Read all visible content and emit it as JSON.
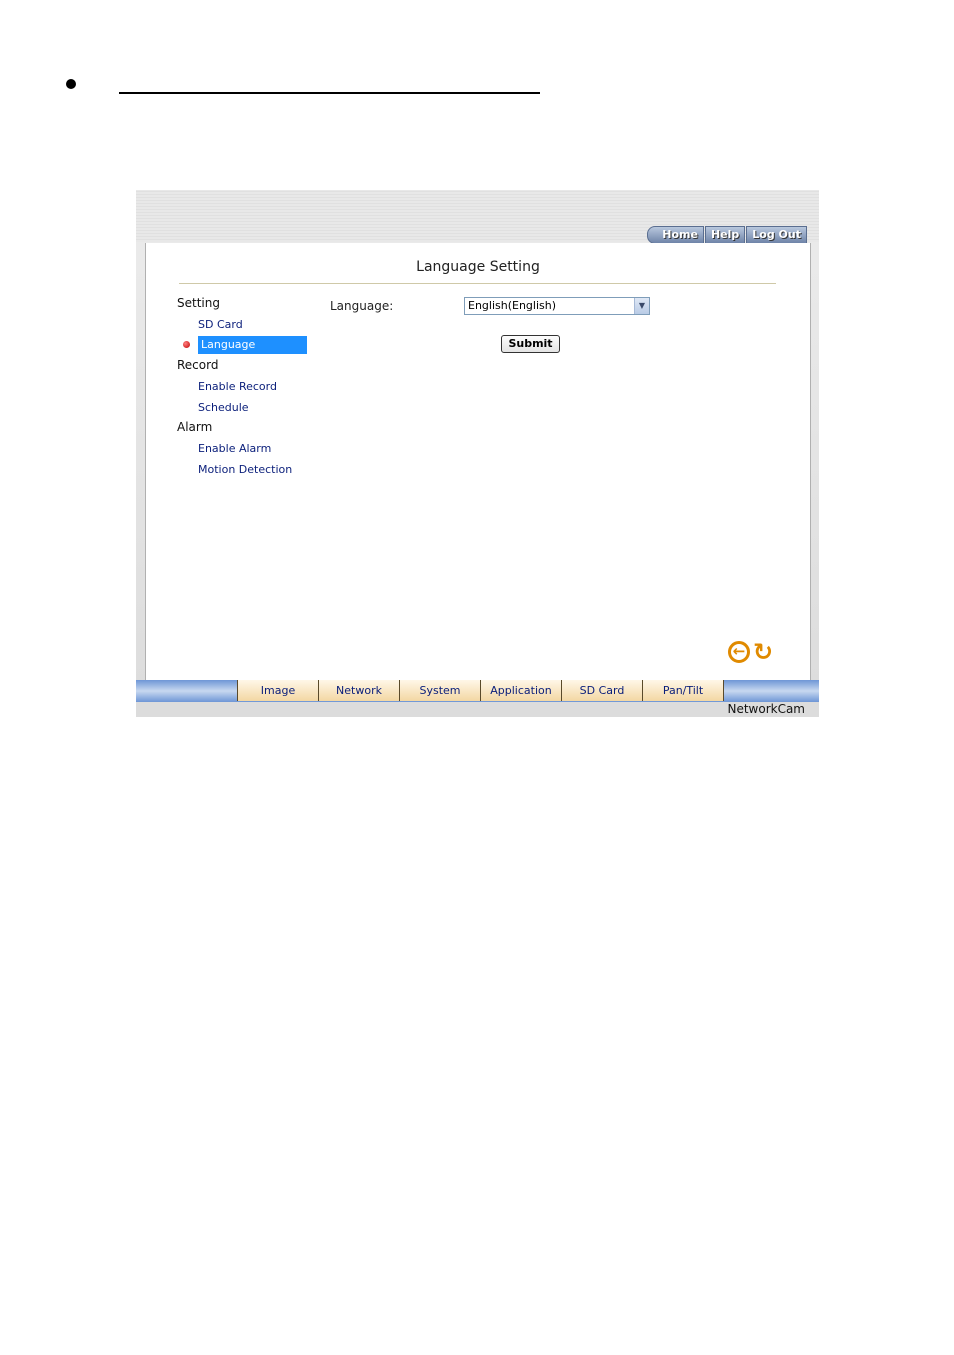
{
  "top_nav": {
    "home": "Home",
    "help": "Help",
    "logout": "Log Out"
  },
  "page_title": "Language Setting",
  "sidebar": {
    "sections": [
      {
        "label": "Setting",
        "items": [
          "SD Card",
          "Language"
        ]
      },
      {
        "label": "Record",
        "items": [
          "Enable Record",
          "Schedule"
        ]
      },
      {
        "label": "Alarm",
        "items": [
          "Enable Alarm",
          "Motion Detection"
        ]
      }
    ],
    "active_item": "Language"
  },
  "form": {
    "language_label": "Language:",
    "language_value": "English(English)",
    "submit_label": "Submit"
  },
  "bottom_tabs": [
    "Image",
    "Network",
    "System",
    "Application",
    "SD Card",
    "Pan/Tilt"
  ],
  "footer_brand": "NetworkCam",
  "icons": {
    "back": "back-arrow-icon",
    "refresh": "refresh-icon"
  },
  "colors": {
    "accent": "#1e90ff",
    "icon_orange": "#e08a00",
    "bottom_bar": "#6e96d6"
  }
}
